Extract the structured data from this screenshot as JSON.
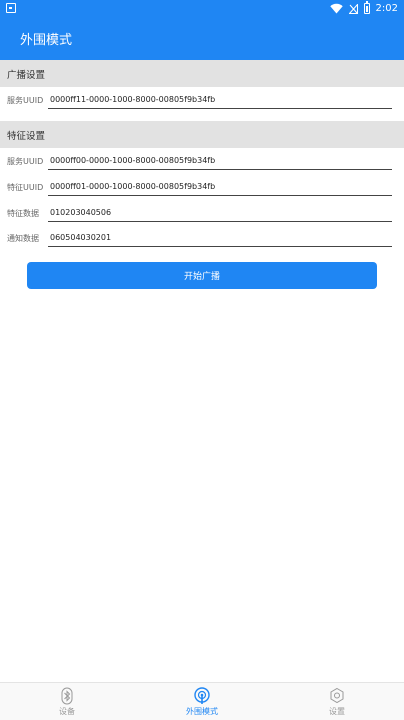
{
  "status_bar": {
    "time": "2:02"
  },
  "app_bar": {
    "title": "外围模式"
  },
  "advertising": {
    "header": "广播设置",
    "service_uuid_label": "服务UUID",
    "service_uuid_value": "0000ff11-0000-1000-8000-00805f9b34fb"
  },
  "characteristic": {
    "header": "特征设置",
    "rows": [
      {
        "label": "服务UUID",
        "value": "0000ff00-0000-1000-8000-00805f9b34fb"
      },
      {
        "label": "特征UUID",
        "value": "0000ff01-0000-1000-8000-00805f9b34fb"
      },
      {
        "label": "特征数据",
        "value": "010203040506"
      },
      {
        "label": "通知数据",
        "value": "060504030201"
      }
    ]
  },
  "start_button": {
    "label": "开始广播"
  },
  "bottom_nav": {
    "items": [
      {
        "label": "设备",
        "icon": "bluetooth-icon"
      },
      {
        "label": "外围模式",
        "icon": "broadcast-icon",
        "active": true
      },
      {
        "label": "设置",
        "icon": "gear-icon"
      }
    ]
  },
  "colors": {
    "primary": "#1f86f3",
    "section_bg": "#e2e2e2",
    "nav_inactive": "#999999"
  }
}
